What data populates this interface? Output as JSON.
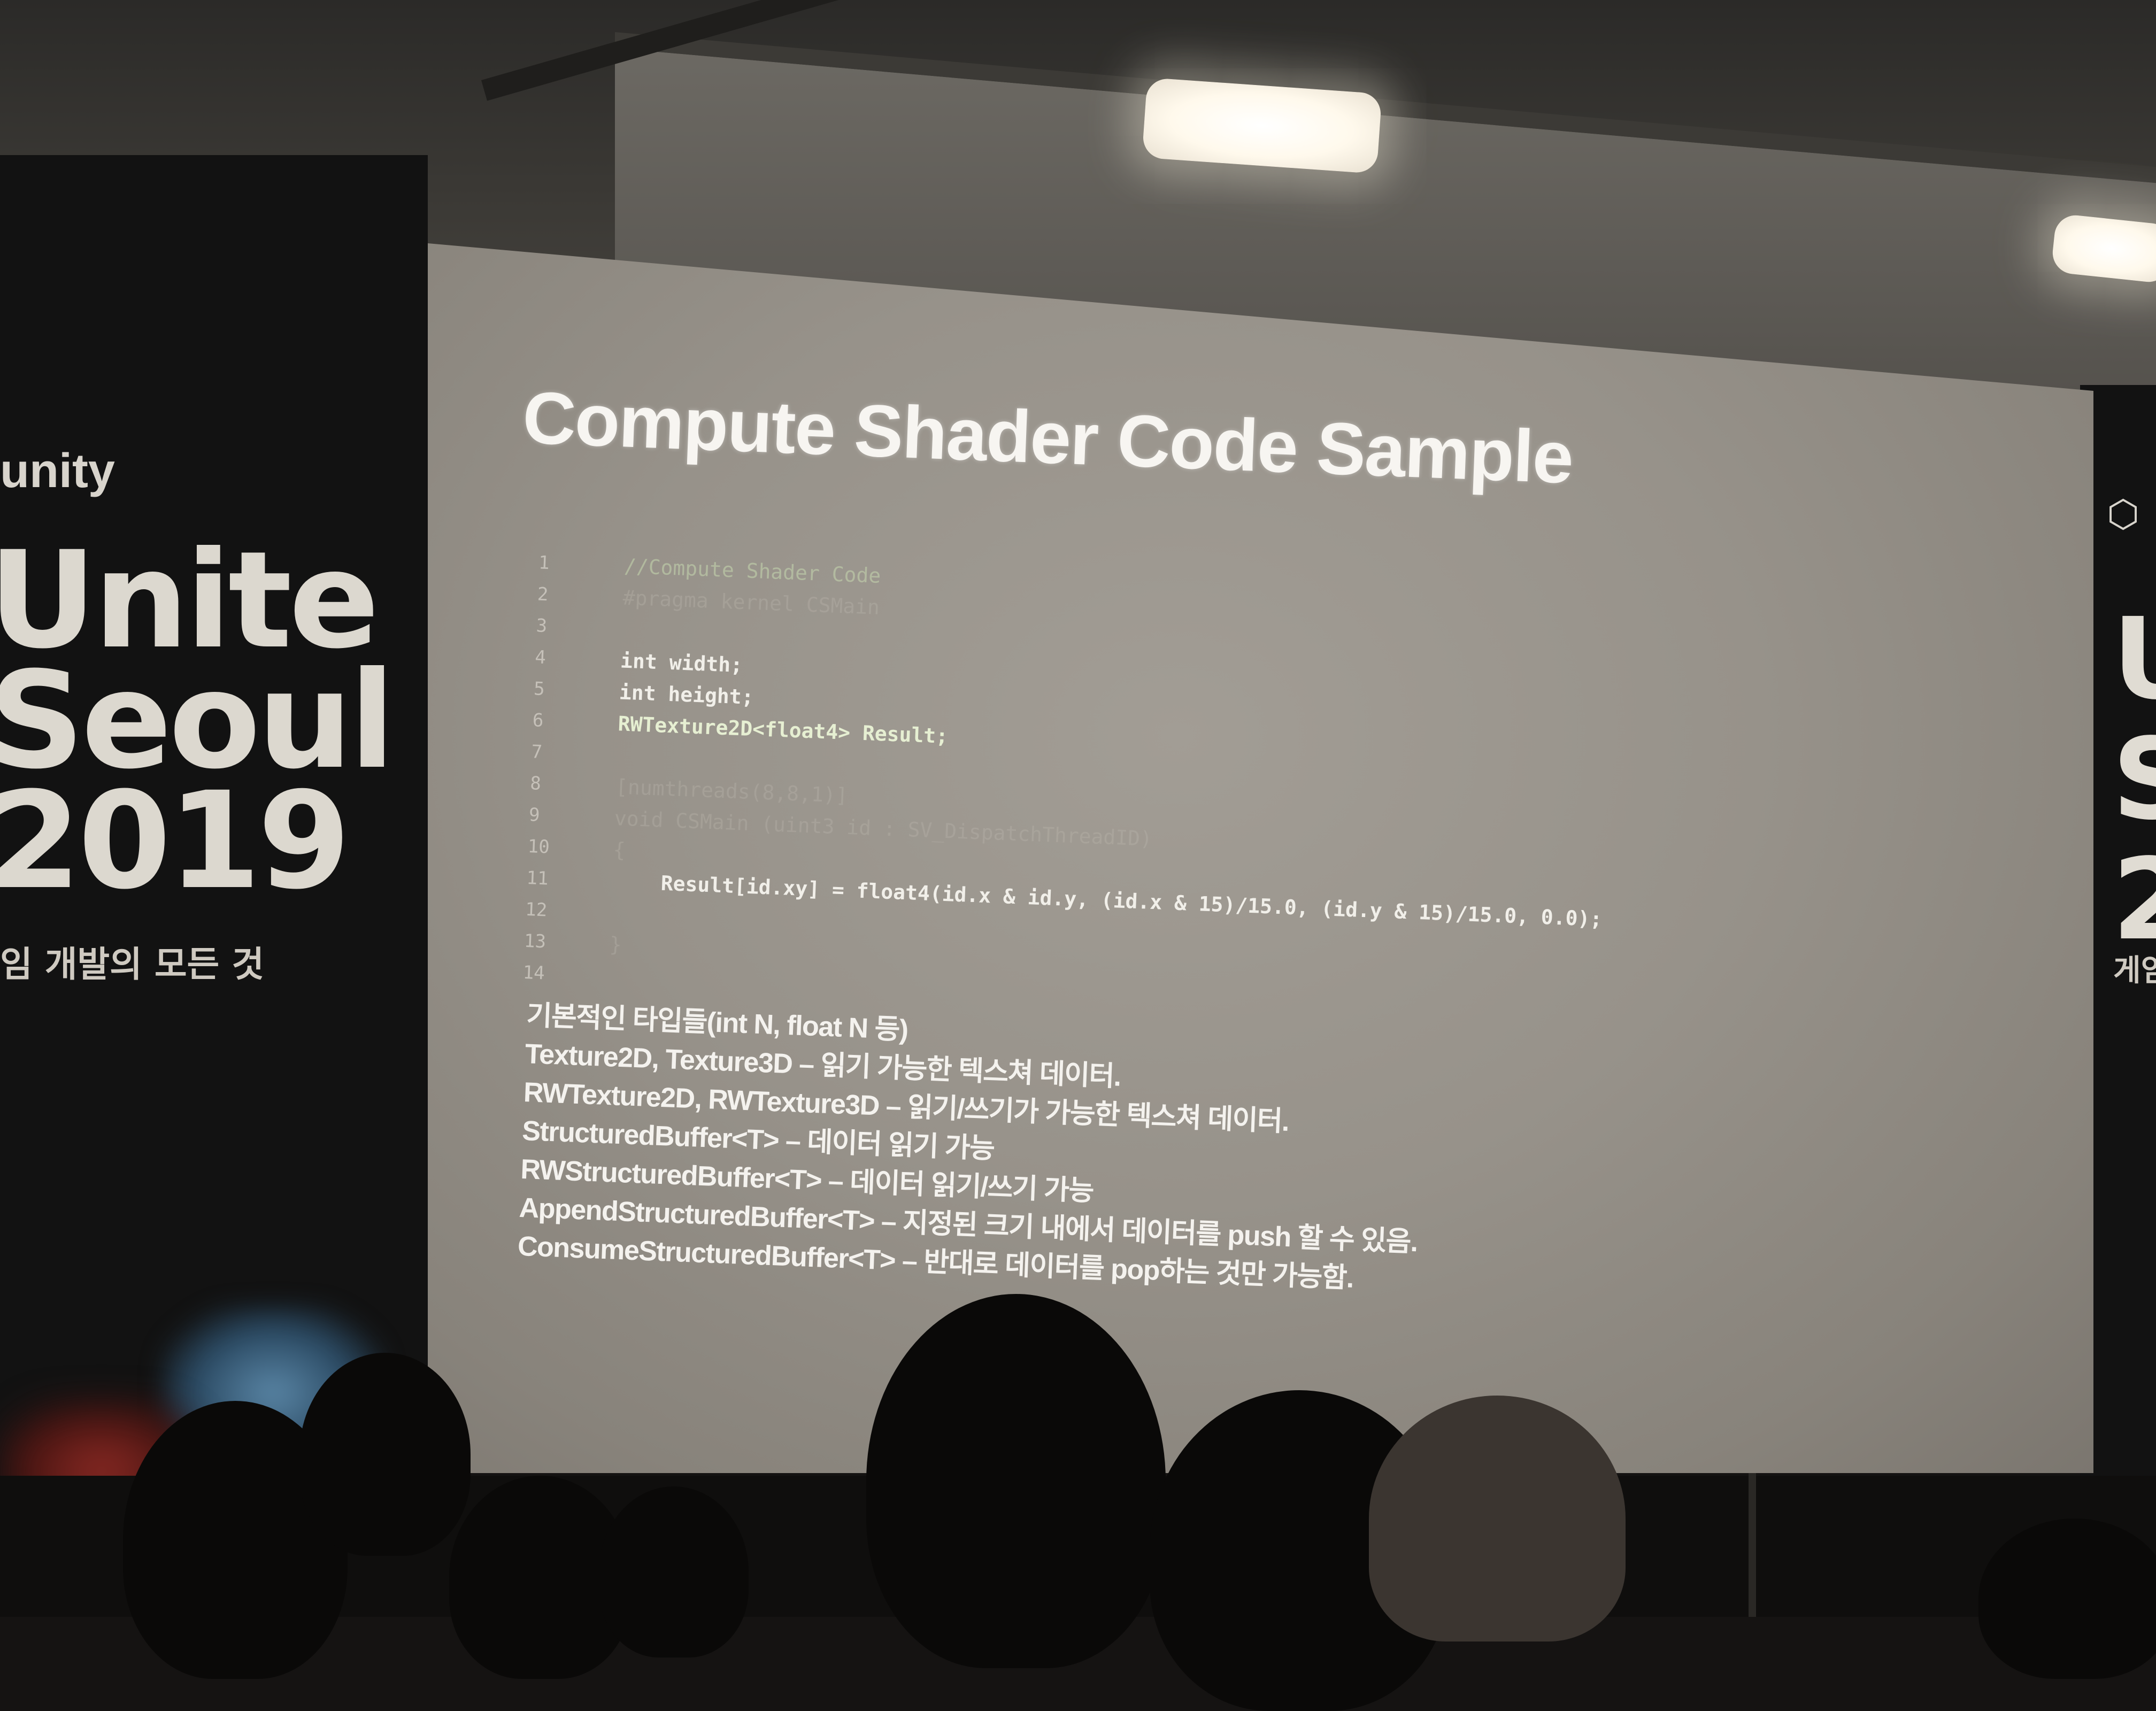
{
  "left_banner": {
    "logo": "unity",
    "title_lines": [
      "Unite",
      "Seoul",
      "2019"
    ],
    "tagline": "임 개발의 모든 것"
  },
  "right_banner": {
    "logo_icon": "unity-cube-icon",
    "title_letters": [
      "U",
      "S",
      "2"
    ],
    "tagline": "게임"
  },
  "slide": {
    "title": "Compute Shader Code Sample",
    "code_lines": [
      {
        "num": "1",
        "text": "//Compute Shader Code",
        "style": "comment"
      },
      {
        "num": "2",
        "text": "#pragma kernel CSMain",
        "style": "faded"
      },
      {
        "num": "3",
        "text": "",
        "style": "plain"
      },
      {
        "num": "4",
        "text": "int width;",
        "style": "plain"
      },
      {
        "num": "5",
        "text": "int height;",
        "style": "plain"
      },
      {
        "num": "6",
        "text": "RWTexture2D<float4> Result;",
        "style": "type"
      },
      {
        "num": "7",
        "text": "",
        "style": "plain"
      },
      {
        "num": "8",
        "text": "[numthreads(8,8,1)]",
        "style": "faded"
      },
      {
        "num": "9",
        "text": "void CSMain (uint3 id : SV_DispatchThreadID)",
        "style": "faded"
      },
      {
        "num": "10",
        "text": "{",
        "style": "faded"
      },
      {
        "num": "11",
        "text": "    Result[id.xy] = float4(id.x & id.y, (id.x & 15)/15.0, (id.y & 15)/15.0, 0.0);",
        "style": "plain"
      },
      {
        "num": "12",
        "text": "",
        "style": "plain"
      },
      {
        "num": "13",
        "text": "}",
        "style": "faded"
      },
      {
        "num": "14",
        "text": "",
        "style": "plain"
      }
    ],
    "bullets": [
      "기본적인 타입들(int N, float N 등)",
      "Texture2D, Texture3D – 읽기 가능한 텍스쳐 데이터.",
      "RWTexture2D, RWTexture3D – 읽기/쓰기가 가능한 텍스쳐 데이터.",
      "StructuredBuffer<T> – 데이터 읽기 가능",
      "RWStructuredBuffer<T> – 데이터 읽기/쓰기 가능",
      "AppendStructuredBuffer<T> – 지정된 크기 내에서 데이터를 push 할 수 있음.",
      "ConsumeStructuredBuffer<T> – 반대로 데이터를 pop하는 것만 가능함."
    ]
  }
}
